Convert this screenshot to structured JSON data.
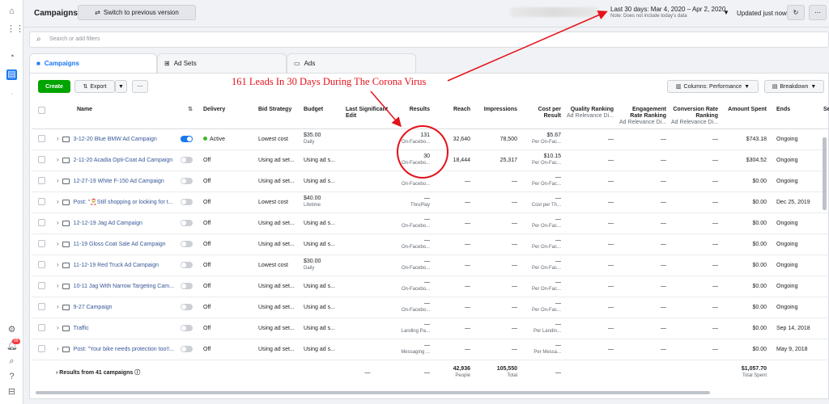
{
  "rail": {
    "icons": [
      "home-icon",
      "apps-grid-icon",
      "dashboard-gauge-icon",
      "table-icon",
      "settings-icon",
      "notifications-icon",
      "search-icon",
      "help-icon",
      "reports-icon"
    ],
    "notification_count": "99"
  },
  "topbar": {
    "title": "Campaigns",
    "switch_label": "Switch to previous version",
    "date_range": "Last 30 days: Mar 4, 2020 – Apr 2, 2020",
    "date_note": "Note: Does not include today's data",
    "updated": "Updated just now"
  },
  "search": {
    "placeholder": "Search or add filters"
  },
  "tabs": [
    {
      "label": "Campaigns"
    },
    {
      "label": "Ad Sets"
    },
    {
      "label": "Ads"
    }
  ],
  "toolbar": {
    "create": "Create",
    "export": "Export",
    "columns": "Columns: Performance",
    "breakdown": "Breakdown"
  },
  "annotation": "161 Leads In 30 Days During The Corona Virus",
  "columns": {
    "name": "Name",
    "delivery": "Delivery",
    "bid": "Bid Strategy",
    "budget": "Budget",
    "last_edit": "Last Significant Edit",
    "results": "Results",
    "reach": "Reach",
    "impressions": "Impressions",
    "cpr": "Cost per Result",
    "quality": "Quality Ranking",
    "quality_sub": "Ad Relevance Di...",
    "engagement": "Engagement Rate Ranking",
    "engagement_sub": "Ad Relevance Di...",
    "conversion": "Conversion Rate Ranking",
    "conversion_sub": "Ad Relevance Di...",
    "spent": "Amount Spent",
    "ends": "Ends",
    "s": "Se"
  },
  "rows": [
    {
      "name": "3-12-20 Blue BMW Ad Campaign",
      "toggle": "on",
      "delivery": "Active",
      "bid": "Lowest cost",
      "budget": "$35.00",
      "budget_sub": "Daily",
      "edit": "",
      "results": "131",
      "results_sub": "On-Facebo...",
      "reach": "32,640",
      "impressions": "78,500",
      "cpr": "$5.67",
      "cpr_sub": "Per On-Fac...",
      "quality": "—",
      "engagement": "—",
      "conversion": "—",
      "spent": "$743.18",
      "ends": "Ongoing"
    },
    {
      "name": "2-11-20 Acadia Opti-Coat Ad Campaign",
      "toggle": "off",
      "delivery": "Off",
      "bid": "Using ad set...",
      "budget": "Using ad s...",
      "budget_sub": "",
      "edit": "",
      "results": "30",
      "results_sub": "On-Facebo...",
      "reach": "18,444",
      "impressions": "25,317",
      "cpr": "$10.15",
      "cpr_sub": "Per On-Fac...",
      "quality": "—",
      "engagement": "—",
      "conversion": "—",
      "spent": "$304.52",
      "ends": "Ongoing"
    },
    {
      "name": "12-27-19 White F-150 Ad Campaign",
      "toggle": "off",
      "delivery": "Off",
      "bid": "Using ad set...",
      "budget": "Using ad s...",
      "budget_sub": "",
      "edit": "",
      "results": "—",
      "results_sub": "On-Facebo...",
      "reach": "—",
      "impressions": "—",
      "cpr": "—",
      "cpr_sub": "Per On-Fac...",
      "quality": "—",
      "engagement": "—",
      "conversion": "—",
      "spent": "$0.00",
      "ends": "Ongoing"
    },
    {
      "name": "Post: \"🎅Still shopping or looking for t...",
      "toggle": "off",
      "delivery": "Off",
      "bid": "Lowest cost",
      "budget": "$40.00",
      "budget_sub": "Lifetime",
      "edit": "",
      "results": "—",
      "results_sub": "ThruPlay",
      "reach": "—",
      "impressions": "—",
      "cpr": "—",
      "cpr_sub": "Cost per Th...",
      "quality": "—",
      "engagement": "—",
      "conversion": "—",
      "spent": "$0.00",
      "ends": "Dec 25, 2019"
    },
    {
      "name": "12-12-19 Jag Ad Campaign",
      "toggle": "off",
      "delivery": "Off",
      "bid": "Using ad set...",
      "budget": "Using ad s...",
      "budget_sub": "",
      "edit": "",
      "results": "—",
      "results_sub": "On-Facebo...",
      "reach": "—",
      "impressions": "—",
      "cpr": "—",
      "cpr_sub": "Per On-Fac...",
      "quality": "—",
      "engagement": "—",
      "conversion": "—",
      "spent": "$0.00",
      "ends": "Ongoing"
    },
    {
      "name": "11-19 Gloss Coat Sale Ad Campaign",
      "toggle": "off",
      "delivery": "Off",
      "bid": "Using ad set...",
      "budget": "Using ad s...",
      "budget_sub": "",
      "edit": "",
      "results": "—",
      "results_sub": "On-Facebo...",
      "reach": "—",
      "impressions": "—",
      "cpr": "—",
      "cpr_sub": "Per On-Fac...",
      "quality": "—",
      "engagement": "—",
      "conversion": "—",
      "spent": "$0.00",
      "ends": "Ongoing"
    },
    {
      "name": "11-12-19 Red Truck Ad Campaign",
      "toggle": "off",
      "delivery": "Off",
      "bid": "Lowest cost",
      "budget": "$30.00",
      "budget_sub": "Daily",
      "edit": "",
      "results": "—",
      "results_sub": "On-Facebo...",
      "reach": "—",
      "impressions": "—",
      "cpr": "—",
      "cpr_sub": "Per On-Fac...",
      "quality": "—",
      "engagement": "—",
      "conversion": "—",
      "spent": "$0.00",
      "ends": "Ongoing"
    },
    {
      "name": "10-11 Jag With Narrow Targeting Cam...",
      "toggle": "off",
      "delivery": "Off",
      "bid": "Using ad set...",
      "budget": "Using ad s...",
      "budget_sub": "",
      "edit": "",
      "results": "—",
      "results_sub": "On-Facebo...",
      "reach": "—",
      "impressions": "—",
      "cpr": "—",
      "cpr_sub": "Per On-Fac...",
      "quality": "—",
      "engagement": "—",
      "conversion": "—",
      "spent": "$0.00",
      "ends": "Ongoing"
    },
    {
      "name": "9-27                         Campaign",
      "toggle": "off",
      "delivery": "Off",
      "bid": "Using ad set...",
      "budget": "Using ad s...",
      "budget_sub": "",
      "edit": "",
      "results": "—",
      "results_sub": "On-Facebo...",
      "reach": "—",
      "impressions": "—",
      "cpr": "—",
      "cpr_sub": "Per On-Fac...",
      "quality": "—",
      "engagement": "—",
      "conversion": "—",
      "spent": "$0.00",
      "ends": "Ongoing"
    },
    {
      "name": "Traffic",
      "toggle": "off",
      "delivery": "Off",
      "bid": "Using ad set...",
      "budget": "Using ad s...",
      "budget_sub": "",
      "edit": "",
      "results": "—",
      "results_sub": "Landing Pa...",
      "reach": "—",
      "impressions": "—",
      "cpr": "—",
      "cpr_sub": "Per Landin...",
      "quality": "—",
      "engagement": "—",
      "conversion": "—",
      "spent": "$0.00",
      "ends": "Sep 14, 2018"
    },
    {
      "name": "Post: \"Your bike needs protection too!!...",
      "toggle": "off",
      "delivery": "Off",
      "bid": "Using ad set...",
      "budget": "Using ad s...",
      "budget_sub": "",
      "edit": "",
      "results": "—",
      "results_sub": "Messaging ...",
      "reach": "—",
      "impressions": "—",
      "cpr": "—",
      "cpr_sub": "Per Messa...",
      "quality": "—",
      "engagement": "—",
      "conversion": "—",
      "spent": "$0.00",
      "ends": "May 9, 2018"
    }
  ],
  "totals": {
    "label": "Results from 41 campaigns",
    "edit": "—",
    "results": "—",
    "reach": "42,936",
    "reach_sub": "People",
    "impressions": "105,550",
    "impressions_sub": "Total",
    "cpr": "—",
    "spent": "$1,057.70",
    "spent_sub": "Total Spent"
  },
  "colors": {
    "accent": "#1877f2",
    "create": "#00a400",
    "annotation": "#e4121a",
    "link": "#385898"
  }
}
